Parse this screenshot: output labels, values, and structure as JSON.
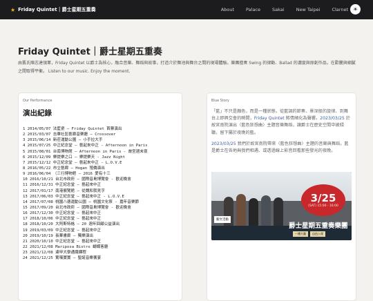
{
  "nav": {
    "brand": "Friday Quintet｜爵士星期五重奏",
    "links": [
      "About",
      "Palace",
      "Sakai",
      "New Taipei",
      "Clarnet"
    ],
    "theme_icon": "sun-icon"
  },
  "hero": {
    "title": "Friday Quintet｜爵士星期五重奏",
    "description": "由舊氏陳志達領軍，Friday Quintet 以爵士為核心，融合音樂、舞蹈與故事，打造介於舞池與舞台之間的現場體驗。樂團擅奏 Swing 的律動、Ballad 的濃度與原創作品，在歡騰與細膩之間取得平衡。 Listen to our music. Enjoy the moment."
  },
  "performances": {
    "eyebrow": "Our Performance",
    "title": "演出紀錄",
    "items": [
      "1 2014/05/07 法藍瓷 — Friday Quintet 首票演出",
      "2 2015/03/07 吉華社區藝廊音樂廳 — Crossover",
      "3 2015/06/14 新莊運動公園 — 小手拉大手",
      "4 2015/07/25 中正紀念堂 — 藝起來中正 - Afternoon in Paris",
      "5 2015/08/01 台南博物館 — Afternoon in Paris - 故宮週末夜",
      "6 2015/12/09 樂提樂之口 — 樂提樂天 - Jazz Night",
      "7 2015/12/12 中正紀念堂 — 藝起來中正 - L.O.V.E",
      "8 2016/05/22 市立藝廊 — Hogan 殖僑演出",
      "9 2016/06/04 （三行博物館 — 2016 愛有十三",
      "10 2016/10/21 台北市政府 — 國際音島博覽會 - 歡迎晚會",
      "11 2016/12/31 中正紀念堂 — 藝起來中正",
      "12 2017/01/17 南港展覽館 — 從魏和我見字",
      "13 2017/06/03 中正紀念堂 — 藝起來中正 - L.O.V.E",
      "14 2017/07/08 桃園八德運動公園 — 桃園文化祭 - 嘉年音樂節",
      "15 2017/09/20 台北市政府 — 國際音島博覽會 - 歡迎晚會",
      "16 2017/12/30 中正紀念堂 — 藝起來中正",
      "17 2018/10/06 中正紀念堂 — 藝起來中正",
      "18 2018/10/20 大阿斯特格 — 20 週年回顧公益演出",
      "19 2019/03/09 中正紀念堂 — 藝起來中正",
      "20 2019/10/19 長華書廊 — 獨樂演出",
      "21 2020/10/10 中正紀念堂 — 藝起來中正",
      "22 2021/12/08 Mariposa Bistro 蝴蝶客廳",
      "23 2021/12/08 達甲大學通識課程",
      "24 2021/12/25 驚嘆寶寶 — 聖誕音樂饗宴"
    ]
  },
  "story": {
    "eyebrow": "Blue Story",
    "p1_a": "「藍」不只是顏色，而是一種狀態，從藍調的節奏、景深般的旋律、到舞台上即興交會的瞬間，",
    "p1_hl1": "Friday Quintet",
    "p1_b": " 將情緒化為聲響。",
    "p1_hl2": "2023/03/25",
    "p1_c": " 於故宮南院演出〈藍色狂想曲〉主題音樂舞蹈，讓爵士在歷史空間中被傾聽，留下屬於夜晚的藍。",
    "p2_hl": "2023/03/25",
    "p2_b": " 我們於故宮南院帶來〈藍色狂想曲〉主題的音樂與舞蹈，藍是爵士在各地與我們相遇、或透過線上影音回看那些發光的夜晚。"
  },
  "poster": {
    "date": "3/25",
    "time": "(SAT) 15:00 - 16:00",
    "title": "爵士星期五重奏樂團",
    "tags": [
      "一樓大廳",
      "自由入席"
    ],
    "category": "藝文活動"
  }
}
